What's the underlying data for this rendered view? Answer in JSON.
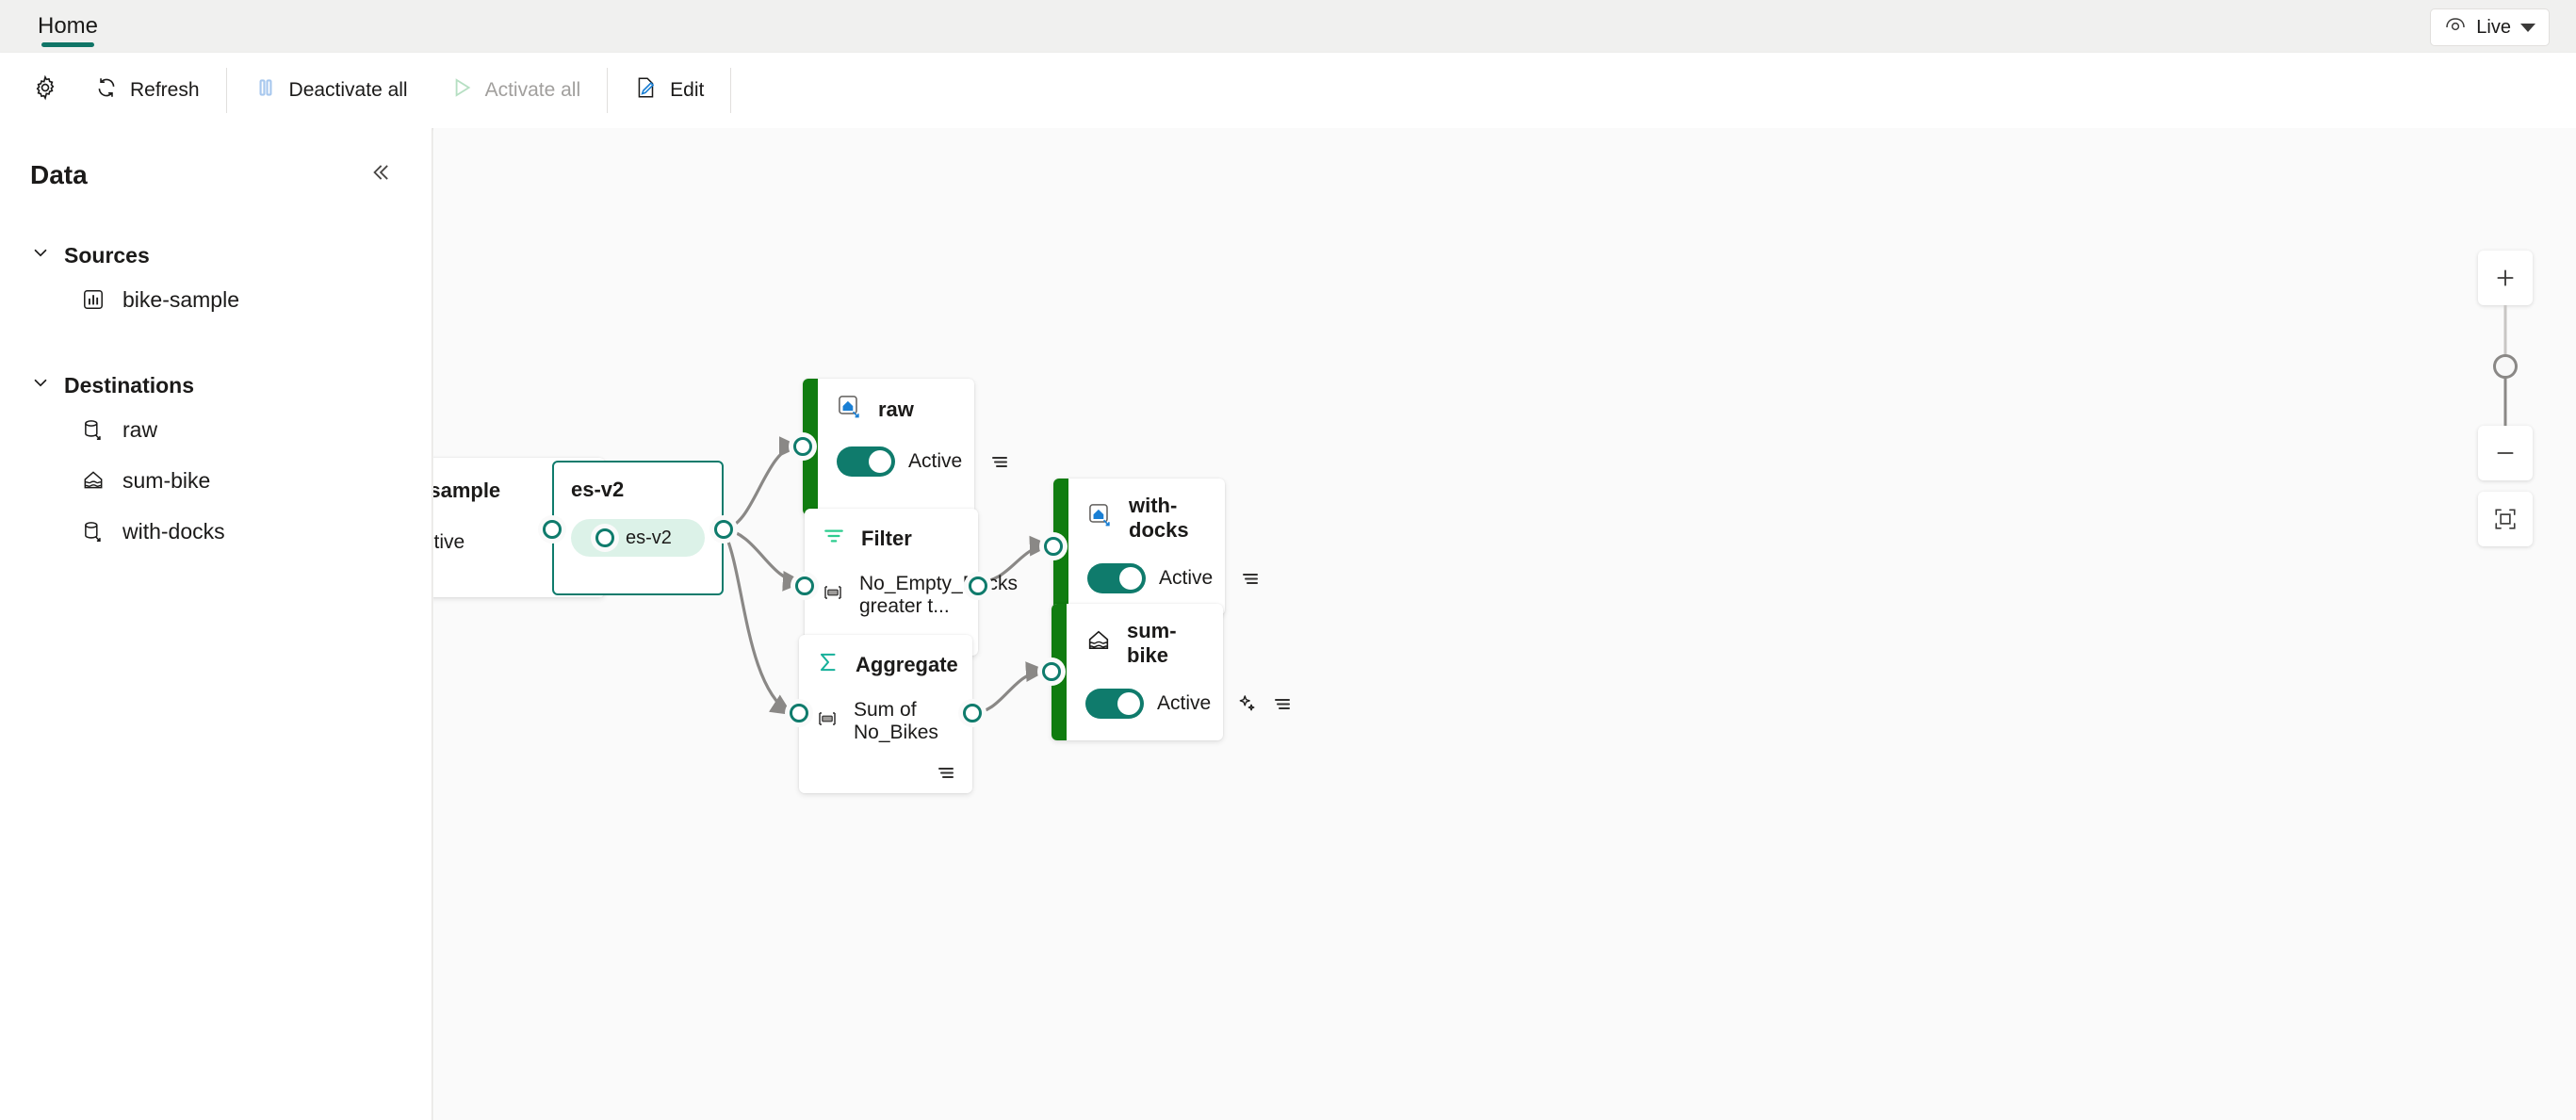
{
  "header": {
    "tabs": [
      {
        "label": "Home",
        "active": true
      }
    ],
    "live_button": {
      "label": "Live",
      "icon": "eye-icon"
    }
  },
  "toolbar": {
    "settings_icon": "gear-icon",
    "items": [
      {
        "label": "Refresh",
        "icon": "refresh-icon",
        "disabled": false
      },
      {
        "label": "Deactivate all",
        "icon": "pause-icon",
        "disabled": false
      },
      {
        "label": "Activate all",
        "icon": "play-icon",
        "disabled": true
      },
      {
        "label": "Edit",
        "icon": "edit-icon",
        "disabled": false
      }
    ]
  },
  "sidebar": {
    "title": "Data",
    "collapse_icon": "chevron-double-left-icon",
    "groups": [
      {
        "label": "Sources",
        "expanded": true,
        "items": [
          {
            "label": "bike-sample",
            "icon": "chart-square-icon"
          }
        ]
      },
      {
        "label": "Destinations",
        "expanded": true,
        "items": [
          {
            "label": "raw",
            "icon": "database-output-icon"
          },
          {
            "label": "sum-bike",
            "icon": "lakehouse-icon"
          },
          {
            "label": "with-docks",
            "icon": "database-output-icon"
          }
        ]
      }
    ]
  },
  "canvas": {
    "nodes": {
      "bike_sample": {
        "title": "bike-sample",
        "icon": "eventstream-source-icon",
        "status": "Active",
        "menu_icon": "more-lines-icon"
      },
      "es_v2": {
        "title": "es-v2",
        "chip_label": "es-v2",
        "chip_icon": "stream-icon"
      },
      "raw": {
        "title": "raw",
        "icon": "lakehouse-destination-icon",
        "status": "Active",
        "menu_icon": "more-lines-icon"
      },
      "filter": {
        "title": "Filter",
        "icon": "filter-icon",
        "subtitle": "No_Empty_Docks greater t...",
        "subtitle_icon": "field-icon",
        "menu_icon": "more-lines-icon"
      },
      "with_docks": {
        "title": "with-docks",
        "icon": "lakehouse-destination-icon",
        "status": "Active",
        "menu_icon": "more-lines-icon"
      },
      "aggregate": {
        "title": "Aggregate",
        "icon": "sigma-icon",
        "subtitle": "Sum of No_Bikes",
        "subtitle_icon": "field-icon",
        "menu_icon": "more-lines-icon"
      },
      "sum_bike": {
        "title": "sum-bike",
        "icon": "lakehouse-icon",
        "status": "Active",
        "sparkle_icon": "sparkle-icon",
        "menu_icon": "more-lines-icon"
      }
    },
    "zoom_controls": {
      "zoom_in": "plus-icon",
      "zoom_out": "minus-icon",
      "fit_to_screen": "fit-screen-icon"
    }
  },
  "colors": {
    "accent_green": "#107C10",
    "brand_teal": "#0f7b6c",
    "chip_bg": "#dcf2e8",
    "canvas_bg": "#fafafa",
    "edge": "#8a8886"
  }
}
